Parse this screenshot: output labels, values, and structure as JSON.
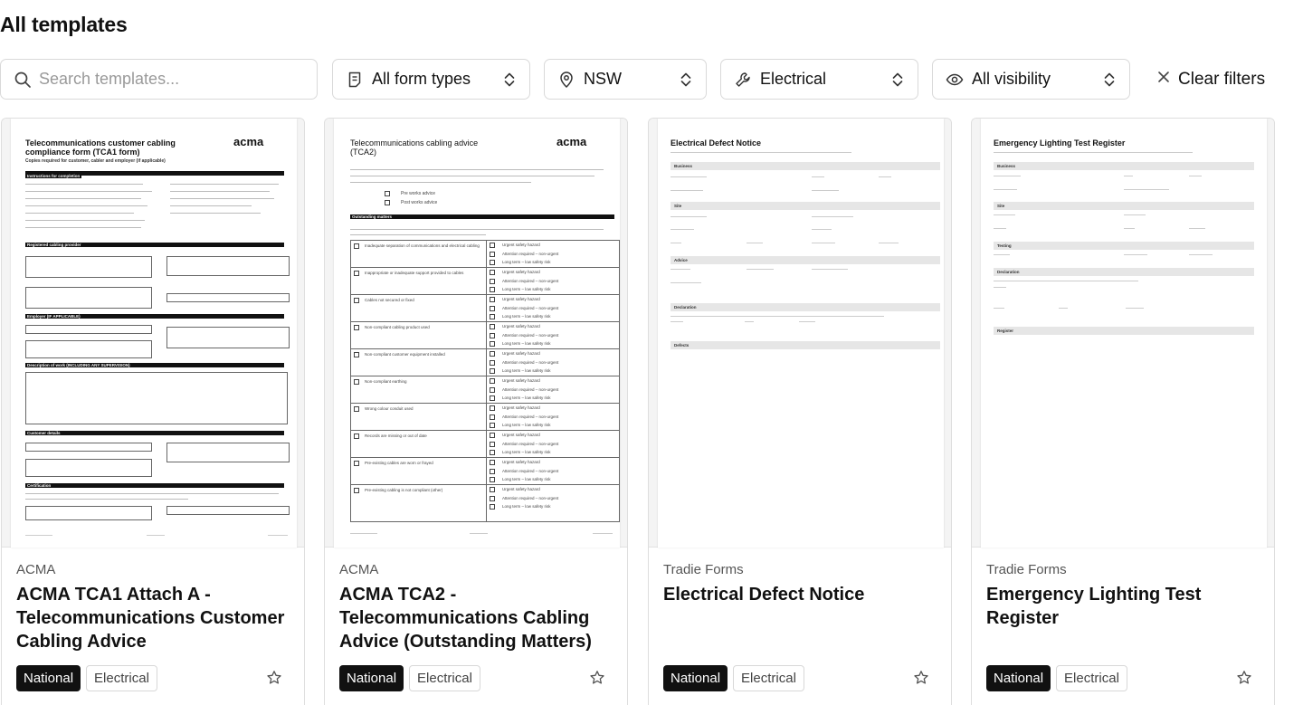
{
  "header": {
    "title": "All templates"
  },
  "filters": {
    "search_placeholder": "Search templates...",
    "form_type": "All form types",
    "region": "NSW",
    "trade": "Electrical",
    "visibility": "All visibility",
    "clear_label": "Clear filters"
  },
  "icons": {
    "search": "search-icon",
    "form_type": "document-icon",
    "region": "map-pin-icon",
    "trade": "wrench-icon",
    "visibility": "eye-icon",
    "chevron": "chevron-updown-icon",
    "clear": "close-icon",
    "favorite": "star-icon"
  },
  "colors": {
    "tag_dark": "#111111",
    "border": "#d9d9d9",
    "muted": "#555555"
  },
  "cards": [
    {
      "provider": "ACMA",
      "title": "ACMA TCA1 Attach A - Telecommunications Customer Cabling Advice",
      "tags": [
        "National",
        "Electrical"
      ],
      "doc": {
        "heading": "Telecommunications customer cabling compliance form (TCA1 form)",
        "subheading": "Copies required for customer, cabler and employer (if applicable)",
        "logo": "acma",
        "sections": [
          "Instructions for completion",
          "Registered cabling provider",
          "Employer (IF APPLICABLE)",
          "Description of work (INCLUDING ANY SUPERVISION)",
          "Customer details",
          "Certification"
        ]
      }
    },
    {
      "provider": "ACMA",
      "title": "ACMA TCA2 - Telecommunications Cabling Advice (Outstanding Matters)",
      "tags": [
        "National",
        "Electrical"
      ],
      "doc": {
        "heading": "Telecommunications cabling advice (TCA2)",
        "logo": "acma",
        "options": [
          "Pre works advice",
          "Post works advice"
        ],
        "section": "Outstanding matters",
        "items": [
          "Inadequate separation of communications and electrical cabling",
          "Inappropriate or inadequate support provided to cables",
          "Cables not secured or fixed",
          "Non-compliant cabling product used",
          "Non-compliant customer equipment installed",
          "Non-compliant earthing",
          "Wrong colour conduit used",
          "Records are missing or out of date",
          "Pre-existing cables are worn or frayed",
          "Pre-existing cabling is not compliant (other)"
        ],
        "levels": [
          "Urgent safety hazard",
          "Attention required – non-urgent",
          "Long term – low safety risk"
        ]
      }
    },
    {
      "provider": "Tradie Forms",
      "title": "Electrical Defect Notice",
      "tags": [
        "National",
        "Electrical"
      ],
      "doc": {
        "heading": "Electrical Defect Notice",
        "sections": [
          "Business",
          "Site",
          "Advice",
          "Declaration",
          "Defects"
        ]
      }
    },
    {
      "provider": "Tradie Forms",
      "title": "Emergency Lighting Test Register",
      "tags": [
        "National",
        "Electrical"
      ],
      "doc": {
        "heading": "Emergency Lighting Test Register",
        "sections": [
          "Business",
          "Site",
          "Testing",
          "Declaration",
          "Register"
        ]
      }
    }
  ]
}
